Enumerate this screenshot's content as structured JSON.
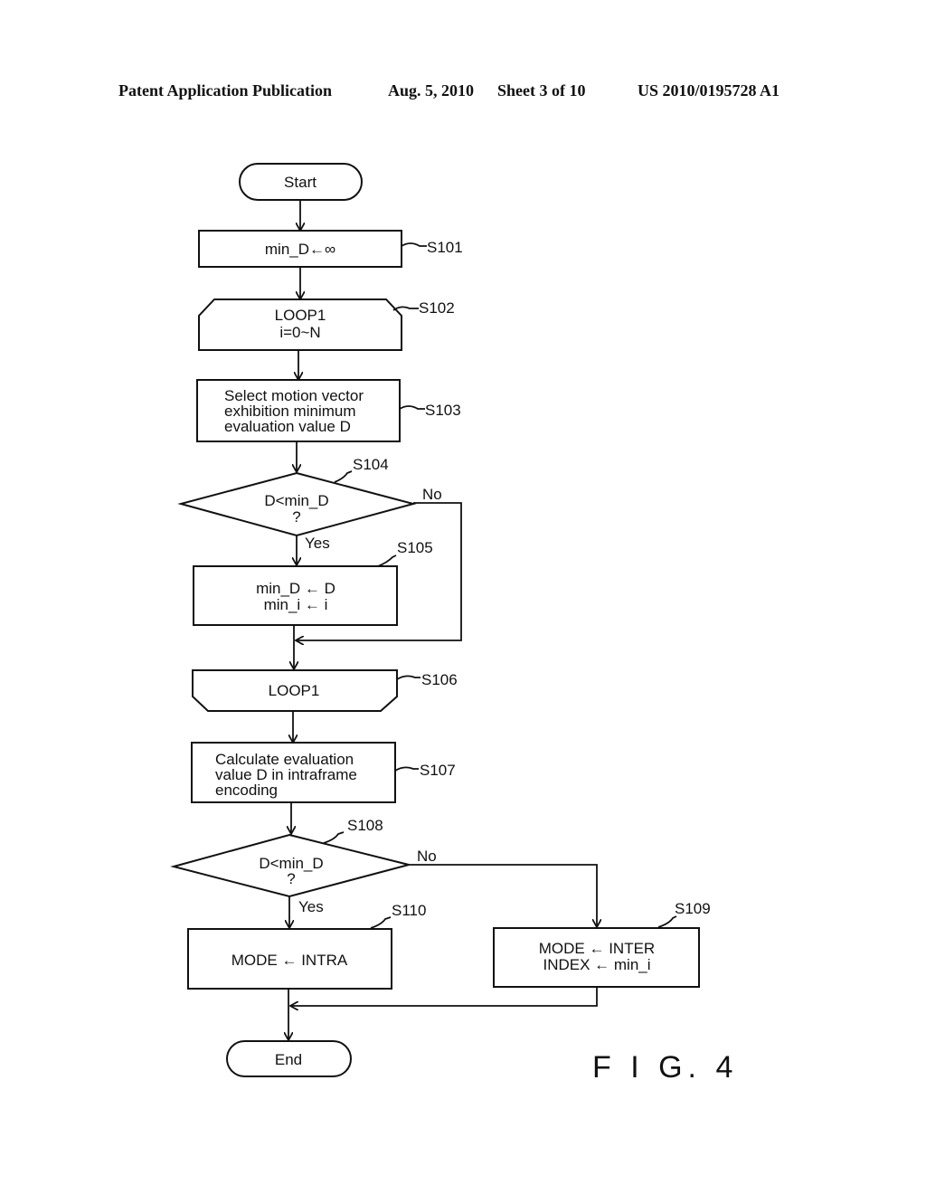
{
  "header": {
    "publication": "Patent Application Publication",
    "date": "Aug. 5, 2010",
    "sheet": "Sheet 3 of 10",
    "number": "US 2010/0195728 A1"
  },
  "figure_label": "F I G. 4",
  "nodes": {
    "start": {
      "text": [
        "Start"
      ]
    },
    "s101": {
      "tag": "S101",
      "text": [
        "min_D←∞"
      ]
    },
    "s102": {
      "tag": "S102",
      "text": [
        "LOOP1",
        "i=0~N"
      ]
    },
    "s103": {
      "tag": "S103",
      "text": [
        "Select motion vector",
        "exhibition minimum",
        "evaluation value D"
      ]
    },
    "s104": {
      "tag": "S104",
      "text": [
        "D<min_D",
        "?"
      ]
    },
    "s105": {
      "tag": "S105",
      "text": [
        "min_D ← D",
        "min_i ← i"
      ]
    },
    "s106": {
      "tag": "S106",
      "text": [
        "LOOP1"
      ]
    },
    "s107": {
      "tag": "S107",
      "text": [
        "Calculate evaluation",
        "value D in intraframe",
        "encoding"
      ]
    },
    "s108": {
      "tag": "S108",
      "text": [
        "D<min_D",
        "?"
      ]
    },
    "s109": {
      "tag": "S109",
      "text": [
        "MODE ← INTER",
        "INDEX ← min_i"
      ]
    },
    "s110": {
      "tag": "S110",
      "text": [
        "MODE ← INTRA"
      ]
    },
    "end": {
      "text": [
        "End"
      ]
    }
  },
  "branch_labels": {
    "s104_yes": "Yes",
    "s104_no": "No",
    "s108_yes": "Yes",
    "s108_no": "No"
  }
}
